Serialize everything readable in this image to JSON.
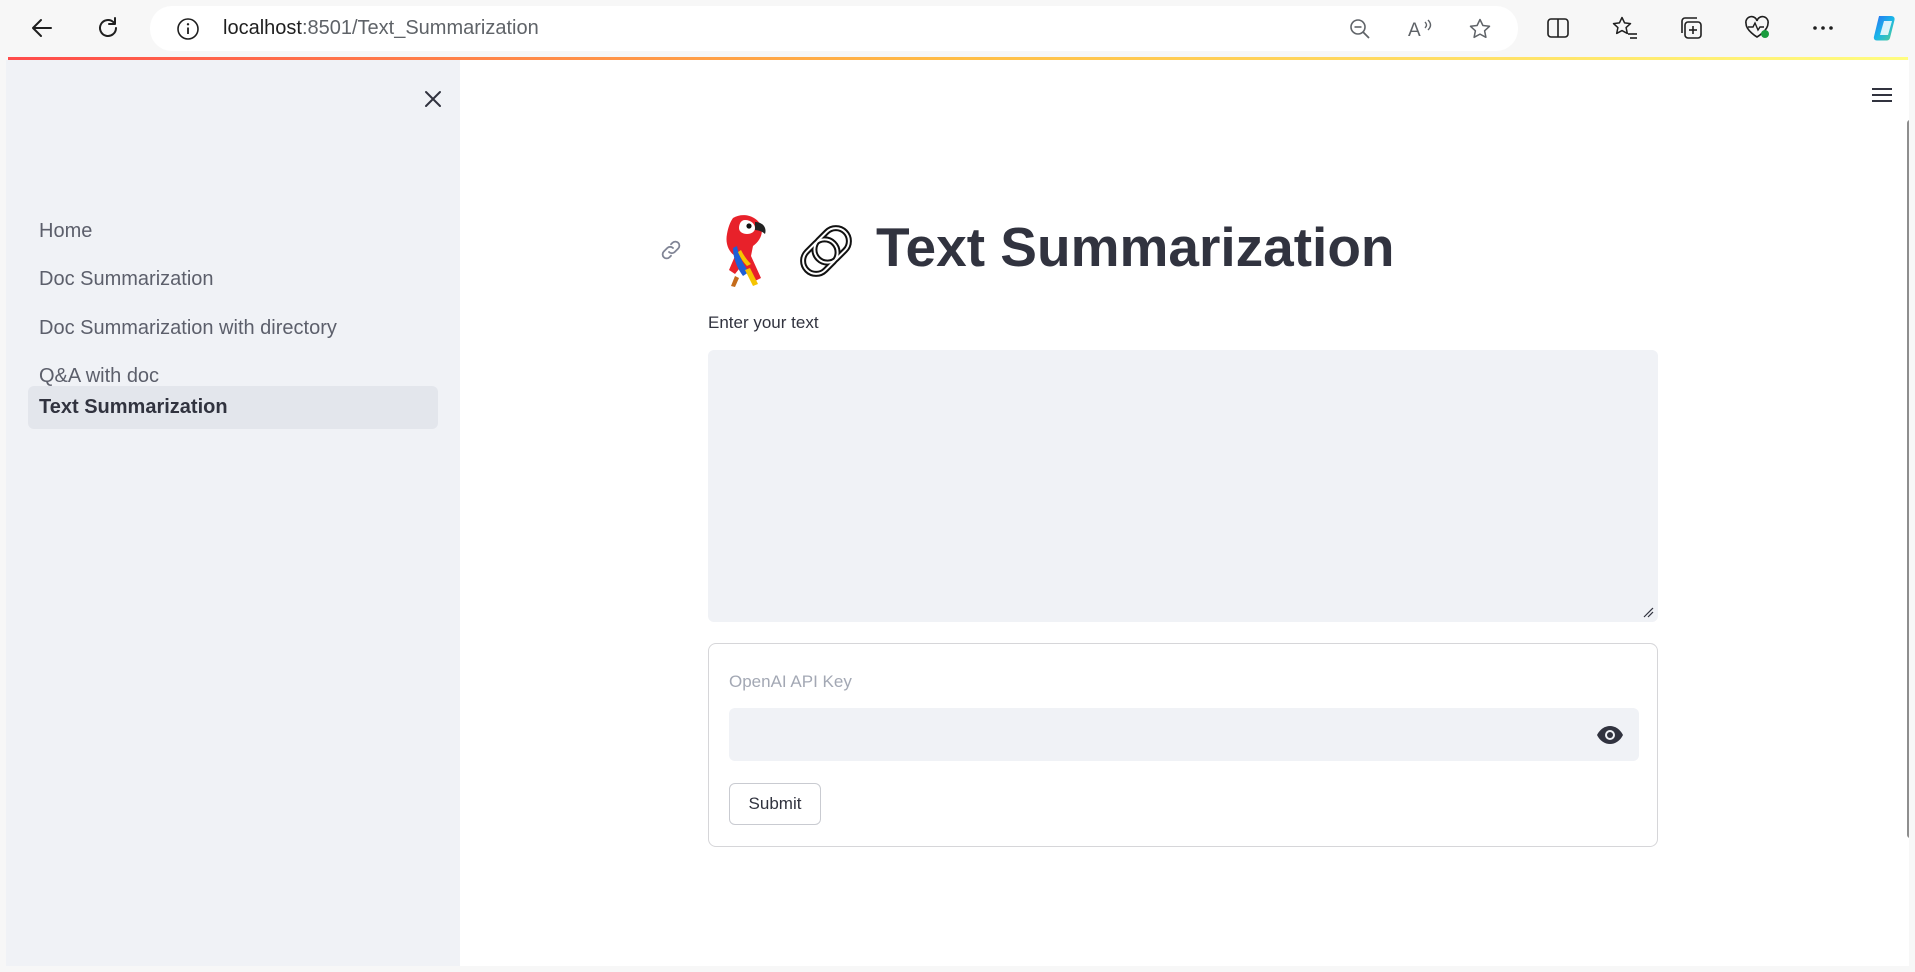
{
  "browser": {
    "url_host": "localhost",
    "url_path": ":8501/Text_Summarization"
  },
  "sidebar": {
    "items": [
      {
        "label": "Home",
        "active": false
      },
      {
        "label": "Doc Summarization",
        "active": false
      },
      {
        "label": "Doc Summarization with directory",
        "active": false
      },
      {
        "label": "Q&A with doc",
        "active": false
      },
      {
        "label": "Text Summarization",
        "active": true
      }
    ]
  },
  "main": {
    "title": "Text Summarization",
    "title_emojis": [
      "parrot",
      "chain-link"
    ],
    "text_input": {
      "label": "Enter your text",
      "value": ""
    },
    "form": {
      "api_key_label": "OpenAI API Key",
      "api_key_value": "",
      "submit_label": "Submit"
    }
  },
  "colors": {
    "accent_gradient_start": "#ff4b4b",
    "accent_gradient_end": "#fffd80",
    "sidebar_bg": "#f0f2f6",
    "text_primary": "#31333f"
  }
}
